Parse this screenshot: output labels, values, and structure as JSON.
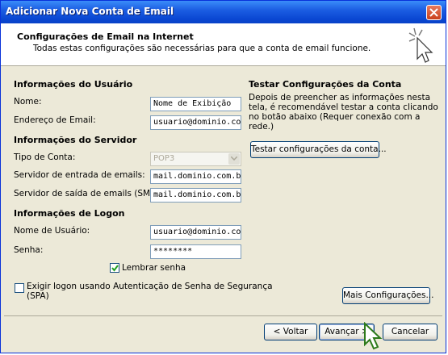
{
  "window": {
    "title": "Adicionar Nova Conta de Email",
    "close_label": "×"
  },
  "header": {
    "title": "Configurações de Email na Internet",
    "subtitle": "Todas estas configurações são necessárias para que a conta de email funcione."
  },
  "user_info": {
    "heading": "Informações do Usuário",
    "name_label": "Nome:",
    "name_value": "Nome de Exibição",
    "email_label": "Endereço de Email:",
    "email_value": "usuario@dominio.com"
  },
  "server_info": {
    "heading": "Informações do Servidor",
    "account_type_label": "Tipo de Conta:",
    "account_type_value": "POP3",
    "incoming_label": "Servidor de entrada de emails:",
    "incoming_value": "mail.dominio.com.br",
    "outgoing_label": "Servidor de saída de emails (SMTP):",
    "outgoing_value": "mail.dominio.com.br"
  },
  "logon_info": {
    "heading": "Informações de Logon",
    "username_label": "Nome de Usuário:",
    "username_value": "usuario@dominio.com",
    "password_label": "Senha:",
    "password_value": "********",
    "remember_label": "Lembrar senha",
    "remember_checked": true,
    "spa_label_line1": "Exigir logon usando Autenticação de Senha de Segurança",
    "spa_label_line2": "(SPA)",
    "spa_checked": false
  },
  "test_settings": {
    "heading": "Testar Configurações da Conta",
    "description": "Depois de preencher as informações nesta tela, é recomendável testar a conta clicando no botão abaixo (Requer conexão com a rede.)",
    "test_button": "Testar configurações da conta...",
    "more_button": "Mais Configurações..."
  },
  "footer": {
    "back_button": "< Voltar",
    "next_button": "Avançar >",
    "cancel_button": "Cancelar"
  },
  "colors": {
    "titlebar": "#0a47d2",
    "dialog_bg": "#ece9d8",
    "field_border": "#7f9db9",
    "button_border": "#003c74"
  },
  "icons": [
    "close-icon",
    "wizard-cursor-icon",
    "checkmark-icon",
    "dropdown-arrow-icon",
    "mouse-pointer-icon"
  ]
}
